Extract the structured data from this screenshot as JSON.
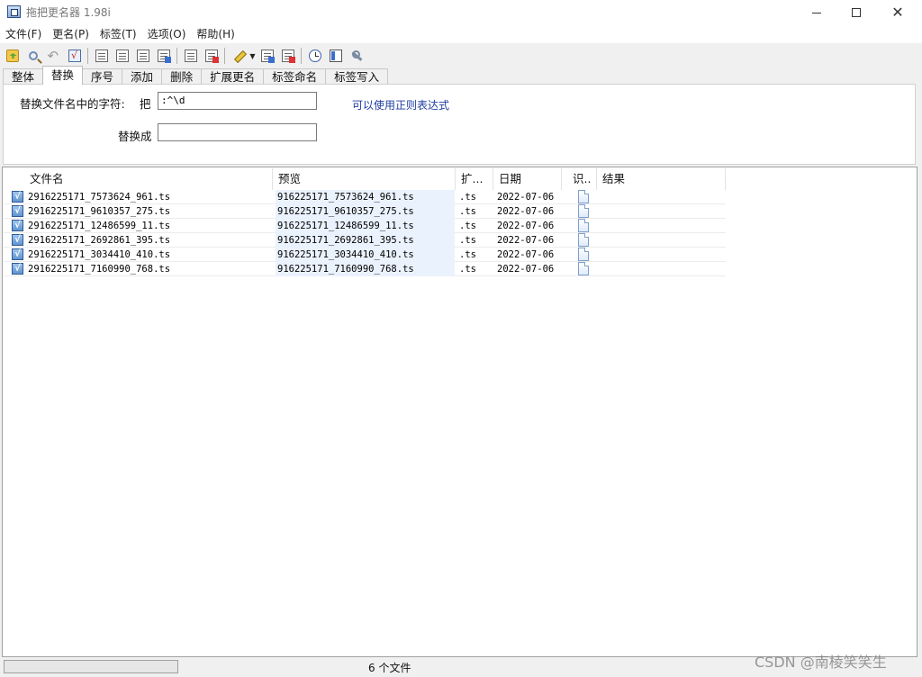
{
  "window": {
    "title": "拖把更名器 1.98i"
  },
  "menu": [
    "文件(F)",
    "更名(P)",
    "标签(T)",
    "选项(O)",
    "帮助(H)"
  ],
  "toolbar": {
    "icons": [
      "open-folder-icon",
      "search-icon",
      "undo-icon",
      "check-icon",
      "doc-icon",
      "doc-icon",
      "doc-icon",
      "doc-icon",
      "list-icon",
      "doc-red-icon",
      "pen-icon",
      "dropdown-icon",
      "doc-blue-icon",
      "doc-red-icon",
      "clock-icon",
      "panel-icon",
      "tools-icon"
    ]
  },
  "tabs": [
    "整体",
    "替换",
    "序号",
    "添加",
    "删除",
    "扩展更名",
    "标签命名",
    "标签写入"
  ],
  "active_tab": "替换",
  "replace": {
    "find_label": "替换文件名中的字符:",
    "ba_label": "把",
    "find_value": ":^\\d",
    "replace_label": "替换成",
    "replace_value": "",
    "regex_hint": "可以使用正则表达式"
  },
  "columns": {
    "filename": "文件名",
    "preview": "预览",
    "ext": "扩...",
    "date": "日期",
    "id": "识..",
    "result": "结果"
  },
  "rows": [
    {
      "filename": "2916225171_7573624_961.ts",
      "preview": "916225171_7573624_961.ts",
      "ext": ".ts",
      "date": "2022-07-06"
    },
    {
      "filename": "2916225171_9610357_275.ts",
      "preview": "916225171_9610357_275.ts",
      "ext": ".ts",
      "date": "2022-07-06"
    },
    {
      "filename": "2916225171_12486599_11.ts",
      "preview": "916225171_12486599_11.ts",
      "ext": ".ts",
      "date": "2022-07-06"
    },
    {
      "filename": "2916225171_2692861_395.ts",
      "preview": "916225171_2692861_395.ts",
      "ext": ".ts",
      "date": "2022-07-06"
    },
    {
      "filename": "2916225171_3034410_410.ts",
      "preview": "916225171_3034410_410.ts",
      "ext": ".ts",
      "date": "2022-07-06"
    },
    {
      "filename": "2916225171_7160990_768.ts",
      "preview": "916225171_7160990_768.ts",
      "ext": ".ts",
      "date": "2022-07-06"
    }
  ],
  "status": {
    "file_count": "6 个文件"
  },
  "watermark": "CSDN @南棱笑笑生",
  "colors": {
    "preview_bg": "#eaf2fd",
    "hint_text": "#1f3ea0",
    "checkbox": "#5f93d1"
  }
}
